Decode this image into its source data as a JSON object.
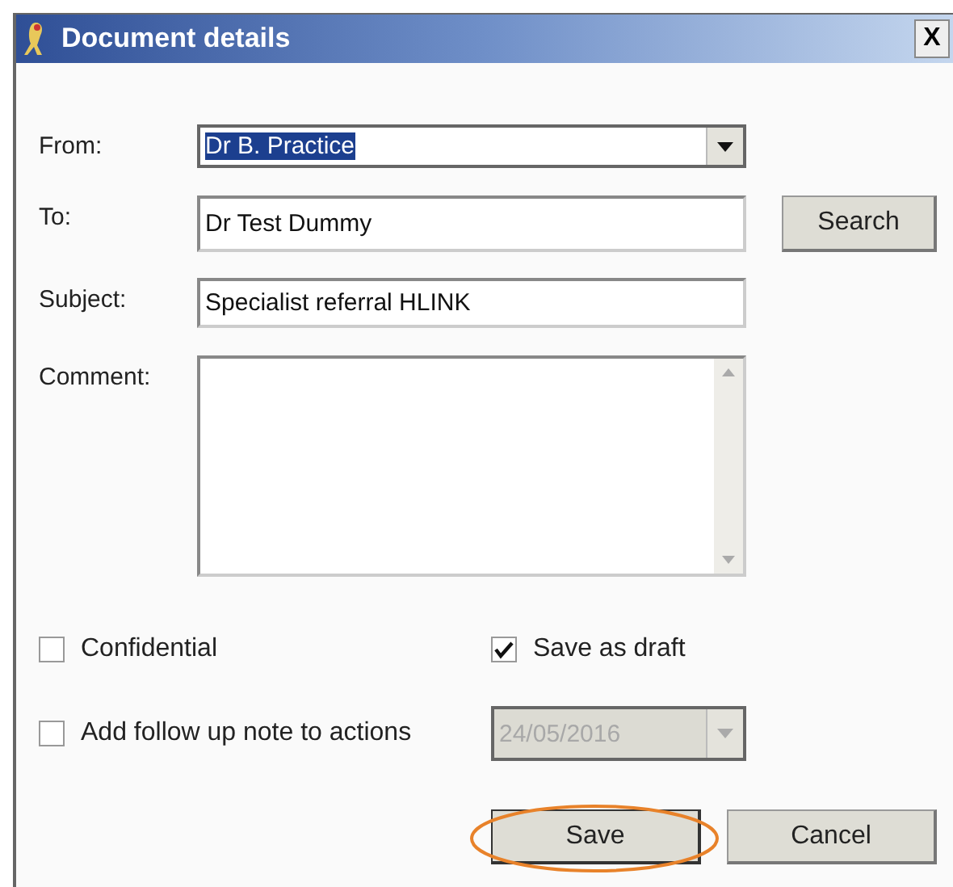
{
  "window": {
    "title": "Document details",
    "close": "X"
  },
  "fields": [
    {
      "kind": "combo",
      "label": "From:",
      "value": "Dr B. Practice",
      "selected": true
    },
    {
      "kind": "text",
      "label": "To:",
      "value": "Dr Test Dummy",
      "button": "Search"
    },
    {
      "kind": "text",
      "label": "Subject:",
      "value": "Specialist referral HLINK"
    },
    {
      "kind": "memo",
      "label": "Comment:"
    }
  ],
  "options": [
    {
      "label": "Confidential",
      "checked": false
    },
    {
      "label": "Save as draft",
      "checked": true
    }
  ],
  "follow_up": {
    "label": "Add follow up note to actions",
    "checked": false,
    "date": "24/05/2016",
    "disabled": true
  },
  "buttons": [
    {
      "label": "Save",
      "highlighted": true
    },
    {
      "label": "Cancel",
      "highlighted": false
    }
  ]
}
